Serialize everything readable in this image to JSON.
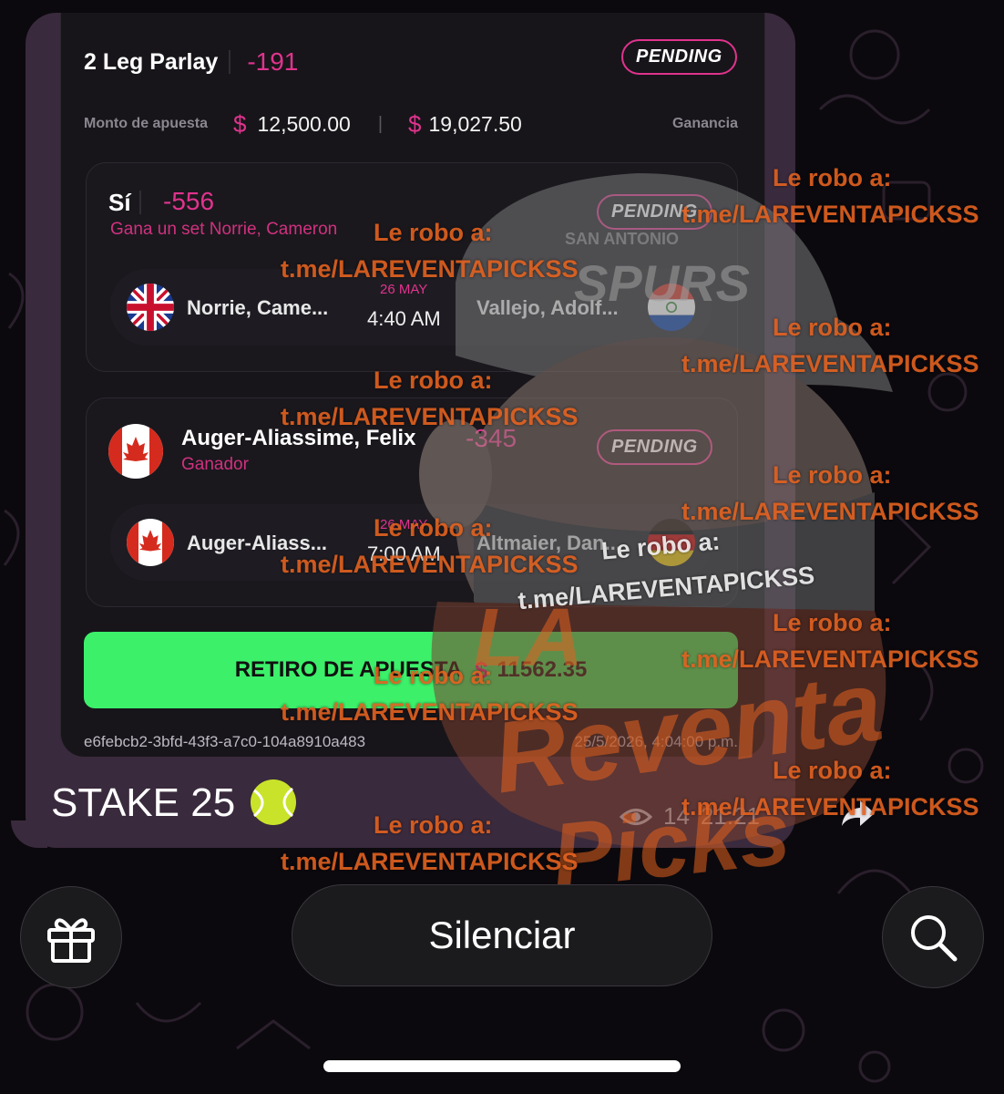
{
  "card": {
    "title": "2 Leg Parlay",
    "odds": "-191",
    "status": "PENDING",
    "stake_label": "Monto de apuesta",
    "currency_symbol": "$",
    "stake_amount": "12,500.00",
    "payout_amount": "19,027.50",
    "payout_label": "Ganancia",
    "legs": [
      {
        "pick": "Sí",
        "odds": "-556",
        "market": "Gana un set Norrie, Cameron",
        "status": "PENDING",
        "home": "Norrie, Came...",
        "date": "26 MAY",
        "time": "4:40 AM",
        "away": "Vallejo, Adolf..."
      },
      {
        "pick": "Auger-Aliassime, Felix",
        "odds": "-345",
        "market": "Ganador",
        "status": "PENDING",
        "home": "Auger-Aliass...",
        "date": "26 MAY",
        "time": "7:00 AM",
        "away": "Altmaier, Dan..."
      }
    ],
    "cashout_label": "RETIRO DE APUESTA",
    "cashout_amount": "11562.35",
    "bet_id": "e6febcb2-3bfd-43f3-a7c0-104a8910a483",
    "placed_at": "25/5/2026, 4:04:00 p.m."
  },
  "message": {
    "caption": "STAKE 25",
    "views": "14",
    "time": "21:21"
  },
  "bottom_bar": {
    "mute_label": "Silenciar"
  },
  "watermark": {
    "line1": "Le robo a:",
    "line2": "t.me/LAREVENTAPICKSS",
    "logo_top": "SAN ANTONIO",
    "logo_team": "SPURS",
    "brand": [
      "LA",
      "Reventa",
      "Picks"
    ]
  },
  "colors": {
    "accent": "#e0338d",
    "cashout": "#3cf06a",
    "watermark": "#e2611f"
  }
}
